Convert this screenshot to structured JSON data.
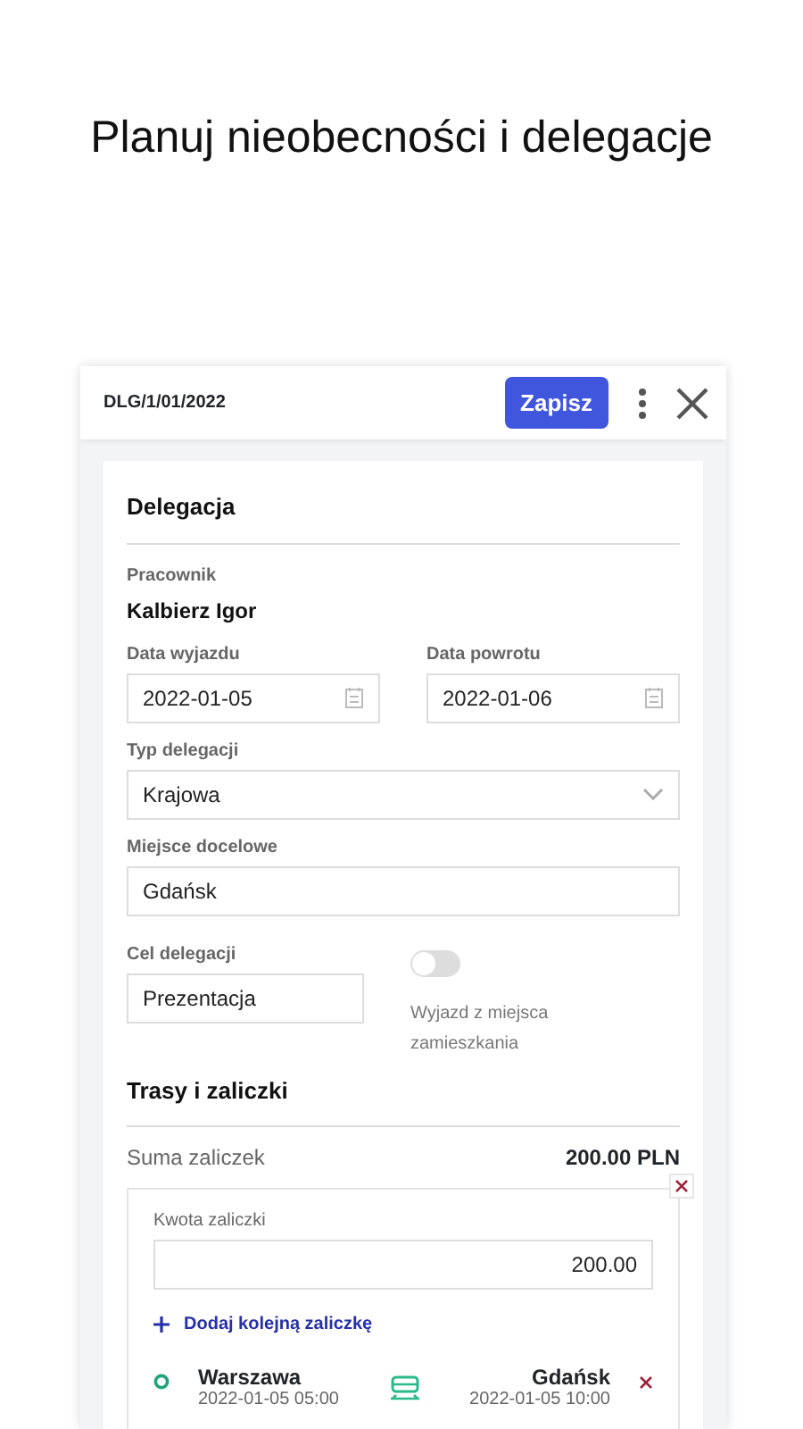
{
  "headline": "Planuj nieobecności i delegacje",
  "header": {
    "title": "DLG/1/01/2022",
    "save_button": "Zapisz"
  },
  "section_title": "Delegacja",
  "employee": {
    "label": "Pracownik",
    "value": "Kalbierz Igor"
  },
  "departure_date": {
    "label": "Data wyjazdu",
    "value": "2022-01-05"
  },
  "return_date": {
    "label": "Data powrotu",
    "value": "2022-01-06"
  },
  "type": {
    "label": "Typ delegacji",
    "value": "Krajowa"
  },
  "destination": {
    "label": "Miejsce docelowe",
    "value": "Gdańsk"
  },
  "purpose": {
    "label": "Cel delegacji",
    "value": "Prezentacja"
  },
  "home_departure": {
    "label": "Wyjazd z miejsca zamieszkania",
    "on": false
  },
  "routes_title": "Trasy i zaliczki",
  "advance_sum": {
    "label": "Suma zaliczek",
    "value": "200.00 PLN"
  },
  "advance": {
    "label": "Kwota zaliczki",
    "value": "200.00",
    "add_link": "Dodaj kolejną zaliczkę"
  },
  "route": {
    "from": "Warszawa",
    "from_time": "2022-01-05 05:00",
    "to": "Gdańsk",
    "to_time": "2022-01-05 10:00"
  }
}
